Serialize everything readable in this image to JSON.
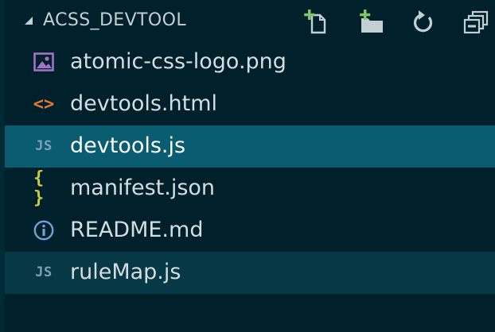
{
  "explorer": {
    "folder_name": "ACSS_DEVTOOL",
    "actions": [
      {
        "name": "new-file-icon"
      },
      {
        "name": "new-folder-icon"
      },
      {
        "name": "refresh-icon"
      },
      {
        "name": "collapse-all-icon"
      }
    ]
  },
  "files": [
    {
      "name": "atomic-css-logo.png",
      "icon": "image-icon",
      "icon_text": ""
    },
    {
      "name": "devtools.html",
      "icon": "html-icon",
      "icon_text": "<>"
    },
    {
      "name": "devtools.js",
      "icon": "js-icon",
      "icon_text": "JS"
    },
    {
      "name": "manifest.json",
      "icon": "json-icon",
      "icon_text": "{ }"
    },
    {
      "name": "README.md",
      "icon": "info-icon",
      "icon_text": ""
    },
    {
      "name": "ruleMap.js",
      "icon": "js-icon",
      "icon_text": "JS"
    }
  ],
  "colors": {
    "background": "#00212b",
    "selected_row": "#0a5c70",
    "active_row": "#063846",
    "accent_green": "#7ec46a",
    "image_purple": "#a074c4",
    "html_orange": "#e37933",
    "json_yellow": "#cbcb41",
    "js_blue": "#7fa0b8",
    "info_blue": "#6fa4d4"
  }
}
